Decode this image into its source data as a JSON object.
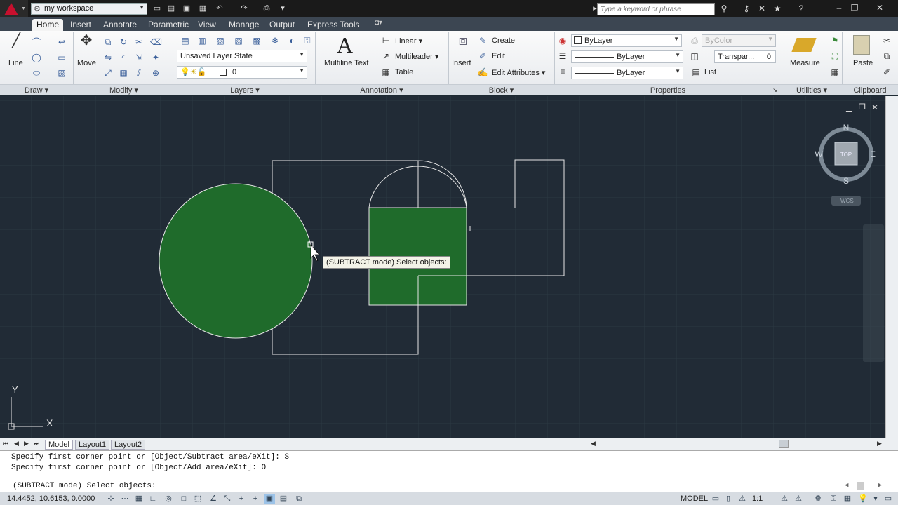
{
  "titlebar": {
    "workspace": "my workspace",
    "search_placeholder": "Type a keyword or phrase"
  },
  "tabs": [
    "Home",
    "Insert",
    "Annotate",
    "Parametric",
    "View",
    "Manage",
    "Output",
    "Express Tools"
  ],
  "ribbon": {
    "draw": {
      "title": "Draw",
      "line_label": "Line"
    },
    "modify": {
      "title": "Modify",
      "move_label": "Move"
    },
    "layers": {
      "title": "Layers",
      "layer_state": "Unsaved Layer State",
      "current_layer": "0"
    },
    "annotation": {
      "title": "Annotation",
      "mtext_label": "Multiline Text",
      "linear_label": "Linear",
      "multileader_label": "Multileader",
      "table_label": "Table"
    },
    "block": {
      "title": "Block",
      "insert_label": "Insert",
      "create_label": "Create",
      "edit_label": "Edit",
      "edit_attr_label": "Edit Attributes"
    },
    "properties": {
      "title": "Properties",
      "color": "ByLayer",
      "linetype": "ByLayer",
      "lineweight": "ByLayer",
      "plotstyle": "ByColor",
      "transparency_label": "Transpar...",
      "transparency_value": "0",
      "list_label": "List"
    },
    "utilities": {
      "title": "Utilities",
      "measure_label": "Measure"
    },
    "clipboard": {
      "title": "Clipboard",
      "paste_label": "Paste"
    }
  },
  "viewcube": {
    "n": "N",
    "s": "S",
    "e": "E",
    "w": "W",
    "top": "TOP",
    "wcs": "WCS"
  },
  "ucs": {
    "x": "X",
    "y": "Y"
  },
  "tooltip": "(SUBTRACT mode) Select objects:",
  "layout_tabs": [
    "Model",
    "Layout1",
    "Layout2"
  ],
  "command": {
    "history": [
      "Specify first corner point or [Object/Subtract area/eXit]: S",
      "Specify first corner point or [Object/Add area/eXit]: O"
    ],
    "prompt": "(SUBTRACT mode) Select objects:"
  },
  "status": {
    "coords": "14.4452, 10.6153, 0.0000",
    "model_label": "MODEL",
    "scale_label": "1:1"
  },
  "colors": {
    "viewport_bg": "#212b36",
    "fill": "#1f6b2b",
    "accent": "#c8102e"
  }
}
